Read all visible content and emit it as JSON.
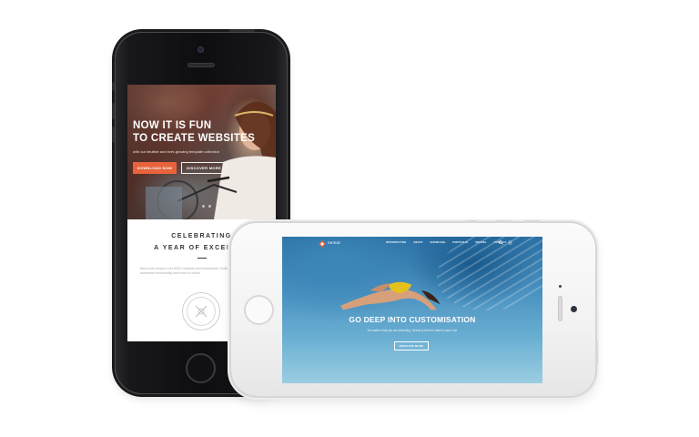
{
  "portrait_phone": {
    "hero": {
      "title_line1": "NOW IT IS FUN",
      "title_line2": "TO CREATE WEBSITES",
      "subtitle": "with our intuitive and ever-growing template collection",
      "download_label": "DOWNLOAD NOW",
      "discover_label": "DISCOVER MORE"
    },
    "section": {
      "heading_line1": "CELEBRATING",
      "heading_line2": "A YEAR OF EXCELENC",
      "body_text": "Bemo has helped over 6000 creatives and businesses. Brilliantly easy to use with awesome functionality and more to follow"
    },
    "colors": {
      "accent": "#e8633b"
    }
  },
  "landscape_phone": {
    "logo_text": "nemat",
    "nav_items": [
      "INTRODUCTION",
      "ABOUT",
      "SHOWCASE",
      "PORTFOLIO",
      "PRICING",
      "CONTACT"
    ],
    "headline": "GO DEEP INTO CUSTOMISATION",
    "subline": "No matter what you are dreaming, Nemat is here to make it come true",
    "discover_label": "DISCOVER MORE"
  }
}
